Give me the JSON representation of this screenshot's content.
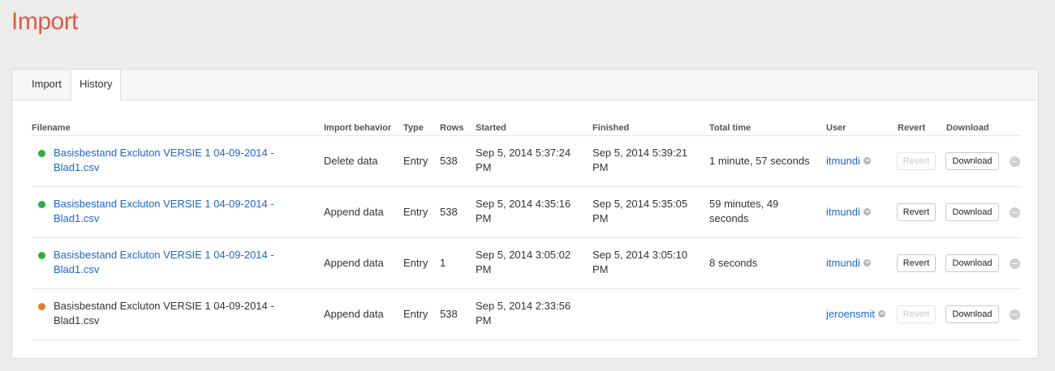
{
  "page": {
    "title": "Import"
  },
  "tabs": [
    {
      "label": "Import"
    },
    {
      "label": "History"
    }
  ],
  "active_tab": "History",
  "table": {
    "headers": {
      "filename": "Filename",
      "behavior": "Import behavior",
      "type": "Type",
      "rows": "Rows",
      "started": "Started",
      "finished": "Finished",
      "total": "Total time",
      "user": "User",
      "revert": "Revert",
      "download": "Download"
    },
    "rows": [
      {
        "status": "success",
        "status_color": "#2dae3f",
        "filename_line1": "Basisbestand Excluton VERSIE 1 04-09-2014 -",
        "filename_line2": "Blad1.csv",
        "behavior": "Delete data",
        "type": "Entry",
        "rows": "538",
        "started_line1": "Sep 5, 2014 5:37:24",
        "started_line2": "PM",
        "finished_line1": "Sep 5, 2014 5:39:21",
        "finished_line2": "PM",
        "total_line1": "1 minute, 57 seconds",
        "total_line2": "",
        "user": "itmundi",
        "revert_label": "Revert",
        "revert_enabled": false,
        "download_label": "Download"
      },
      {
        "status": "success",
        "status_color": "#2dae3f",
        "filename_line1": "Basisbestand Excluton VERSIE 1 04-09-2014 -",
        "filename_line2": "Blad1.csv",
        "behavior": "Append data",
        "type": "Entry",
        "rows": "538",
        "started_line1": "Sep 5, 2014 4:35:16",
        "started_line2": "PM",
        "finished_line1": "Sep 5, 2014 5:35:05",
        "finished_line2": "PM",
        "total_line1": "59 minutes, 49",
        "total_line2": "seconds",
        "user": "itmundi",
        "revert_label": "Revert",
        "revert_enabled": true,
        "download_label": "Download"
      },
      {
        "status": "success",
        "status_color": "#2dae3f",
        "filename_line1": "Basisbestand Excluton VERSIE 1 04-09-2014 -",
        "filename_line2": "Blad1.csv",
        "behavior": "Append data",
        "type": "Entry",
        "rows": "1",
        "started_line1": "Sep 5, 2014 3:05:02",
        "started_line2": "PM",
        "finished_line1": "Sep 5, 2014 3:05:10",
        "finished_line2": "PM",
        "total_line1": "8 seconds",
        "total_line2": "",
        "user": "itmundi",
        "revert_label": "Revert",
        "revert_enabled": true,
        "download_label": "Download"
      },
      {
        "status": "in-progress",
        "status_color": "#ea7a2b",
        "filename_line1": "Basisbestand Excluton VERSIE 1 04-09-2014 -",
        "filename_line2": "Blad1.csv",
        "behavior": "Append data",
        "type": "Entry",
        "rows": "538",
        "started_line1": "Sep 5, 2014 2:33:56",
        "started_line2": "PM",
        "finished_line1": "",
        "finished_line2": "",
        "total_line1": "",
        "total_line2": "",
        "user": "jeroensmit",
        "revert_label": "Revert",
        "revert_enabled": false,
        "download_label": "Download"
      }
    ]
  }
}
